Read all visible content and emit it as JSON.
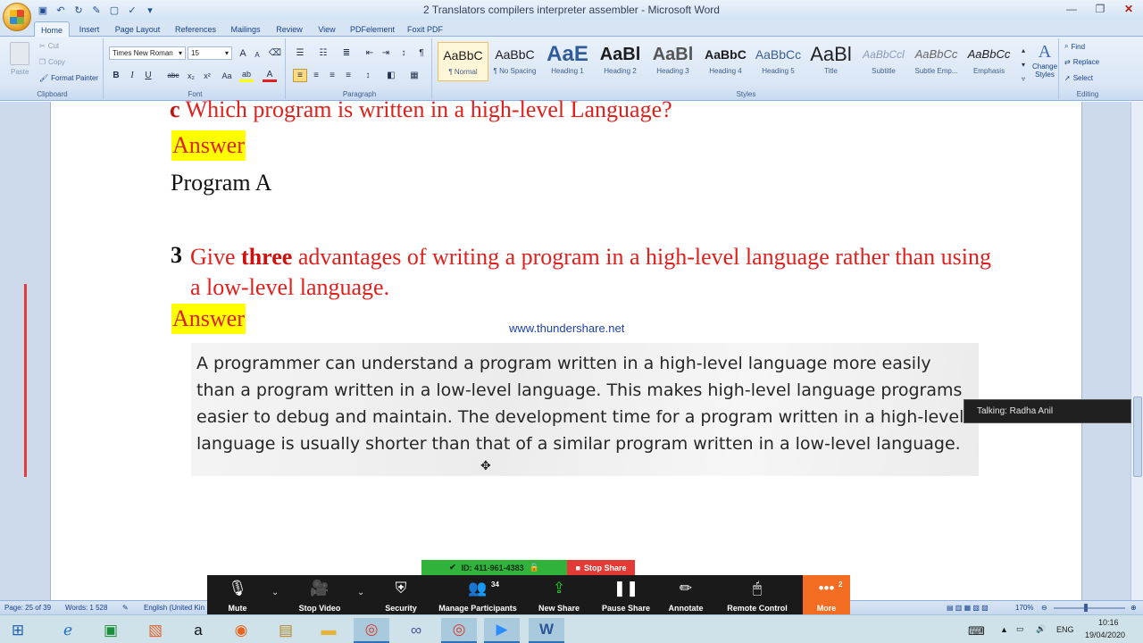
{
  "window": {
    "title": "2 Translators compilers interpreter assembler - Microsoft Word",
    "minimize": "—",
    "maximize": "❐",
    "close": "✕"
  },
  "tabs": [
    "Home",
    "Insert",
    "Page Layout",
    "References",
    "Mailings",
    "Review",
    "View",
    "PDFelement",
    "Foxit PDF"
  ],
  "clipboard": {
    "paste_label": "Paste",
    "cut_label": "Cut",
    "copy_label": "Copy",
    "format_painter_label": "Format Painter",
    "group_label": "Clipboard"
  },
  "font": {
    "name": "Times New Roman",
    "size": "15",
    "group_label": "Font",
    "grow": "A",
    "shrink": "A",
    "clear": "⌫",
    "bold": "B",
    "italic": "I",
    "underline": "U",
    "strike": "abc",
    "subscript": "x₂",
    "superscript": "x²",
    "change_case": "Aa",
    "highlight": "ab",
    "font_color": "A"
  },
  "paragraph": {
    "group_label": "Paragraph",
    "sort": "↕",
    "show_marks": "¶"
  },
  "styles": {
    "group_label": "Styles",
    "items": [
      {
        "sample": "AaBbC",
        "name": "¶ Normal"
      },
      {
        "sample": "AaBbC",
        "name": "¶ No Spacing"
      },
      {
        "sample": "AaE",
        "name": "Heading 1"
      },
      {
        "sample": "AaBl",
        "name": "Heading 2"
      },
      {
        "sample": "AaBl",
        "name": "Heading 3"
      },
      {
        "sample": "AaBbC",
        "name": "Heading 4"
      },
      {
        "sample": "AaBbCc",
        "name": "Heading 5"
      },
      {
        "sample": "AaBl",
        "name": "Title"
      },
      {
        "sample": "AaBbCcl",
        "name": "Subtitle"
      },
      {
        "sample": "AaBbCc",
        "name": "Subtle Emp..."
      },
      {
        "sample": "AaBbCc",
        "name": "Emphasis"
      }
    ],
    "change_styles_line1": "Change",
    "change_styles_line2": "Styles"
  },
  "editing": {
    "group_label": "Editing",
    "find": "Find",
    "replace": "Replace",
    "select": "Select"
  },
  "document": {
    "question_c_letter": "c",
    "question_c_text": "Which program is written in a high-level Language?",
    "answer_label_1": "Answer",
    "program_answer": "Program A",
    "q3_number": "3",
    "q3_prefix": "Give",
    "q3_bold": "three",
    "q3_rest": "advantages of writing a program in a high-level language rather than using a low-level language.",
    "answer_label_2": "Answer",
    "watermark": "www.thundershare.net",
    "scanned_answer": "A programmer can understand a program written in a high-level language more easily than a program written in a low-level language. This makes high-level language programs easier to debug and maintain. The development time for a program written in a high-level language is usually shorter than that of a similar program written in a low-level language."
  },
  "talking_indicator": "Talking: Radha Anil",
  "statusbar": {
    "page": "Page: 25 of 39",
    "words": "Words: 1 528",
    "language": "English (United Kin",
    "zoom": "170%"
  },
  "zoom_meeting": {
    "meeting_id": "ID: 411-961-4383",
    "stop_share": "Stop Share",
    "buttons": {
      "mute": "Mute",
      "stop_video": "Stop Video",
      "security": "Security",
      "manage_participants": "Manage Participants",
      "participants_count": "34",
      "new_share": "New Share",
      "pause_share": "Pause Share",
      "annotate": "Annotate",
      "remote_control": "Remote Control",
      "more": "More",
      "more_badge": "2"
    }
  },
  "taskbar": {
    "language": "ENG",
    "time": "10:16",
    "date": "19/04/2020"
  }
}
